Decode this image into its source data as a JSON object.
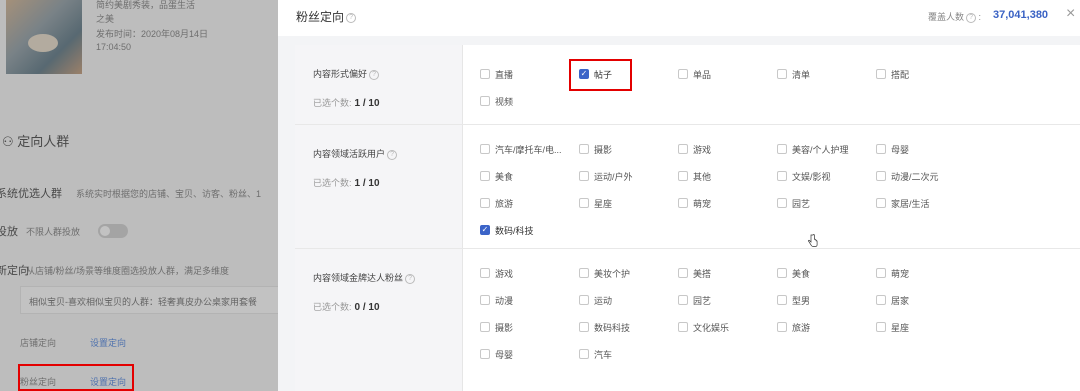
{
  "background": {
    "product_title_line1": "简约美剧秀装，品蛋生活",
    "product_title_line2": "之美",
    "publish_label": "发布时间：2020年08月14日",
    "publish_time": "17:04:50",
    "targeting_heading": "定向人群",
    "system_crowd_label": "系统优选人群",
    "system_crowd_desc": "系统实时根据您的店铺、宝贝、访客、粉丝、1",
    "delivery_label": "投放",
    "delivery_desc": "不限人群投放",
    "custom_label": "新定向",
    "custom_desc": "从店铺/粉丝/场景等维度圈选投放人群，满足多维度",
    "similar_text": "相似宝贝-喜欢相似宝贝的人群：轻奢真皮办公桌家用套餐",
    "store_targeting_label": "店铺定向",
    "store_targeting_link": "设置定向",
    "fan_targeting_label": "粉丝定向",
    "fan_targeting_link": "设置定向"
  },
  "drawer": {
    "title": "粉丝定向",
    "audience_label": "覆盖人数",
    "audience_value": "37,041,380",
    "sections": [
      {
        "label": "内容形式偏好",
        "count_label": "已选个数:",
        "count_value": "1 / 10",
        "options": [
          {
            "label": "直播",
            "checked": false
          },
          {
            "label": "帖子",
            "checked": true
          },
          {
            "label": "单品",
            "checked": false
          },
          {
            "label": "清单",
            "checked": false
          },
          {
            "label": "搭配",
            "checked": false
          },
          {
            "label": "视频",
            "checked": false
          }
        ]
      },
      {
        "label": "内容领域活跃用户",
        "count_label": "已选个数:",
        "count_value": "1 / 10",
        "options": [
          {
            "label": "汽车/摩托车/电...",
            "checked": false
          },
          {
            "label": "摄影",
            "checked": false
          },
          {
            "label": "游戏",
            "checked": false
          },
          {
            "label": "美容/个人护理",
            "checked": false
          },
          {
            "label": "母婴",
            "checked": false
          },
          {
            "label": "美食",
            "checked": false
          },
          {
            "label": "运动/户外",
            "checked": false
          },
          {
            "label": "其他",
            "checked": false
          },
          {
            "label": "文娱/影视",
            "checked": false
          },
          {
            "label": "动漫/二次元",
            "checked": false
          },
          {
            "label": "旅游",
            "checked": false
          },
          {
            "label": "星座",
            "checked": false
          },
          {
            "label": "萌宠",
            "checked": false
          },
          {
            "label": "园艺",
            "checked": false
          },
          {
            "label": "家居/生活",
            "checked": false
          },
          {
            "label": "数码/科技",
            "checked": true
          }
        ]
      },
      {
        "label": "内容领域金牌达人粉丝",
        "count_label": "已选个数:",
        "count_value": "0 / 10",
        "options": [
          {
            "label": "游戏",
            "checked": false
          },
          {
            "label": "美妆个护",
            "checked": false
          },
          {
            "label": "美搭",
            "checked": false
          },
          {
            "label": "美食",
            "checked": false
          },
          {
            "label": "萌宠",
            "checked": false
          },
          {
            "label": "动漫",
            "checked": false
          },
          {
            "label": "运动",
            "checked": false
          },
          {
            "label": "园艺",
            "checked": false
          },
          {
            "label": "型男",
            "checked": false
          },
          {
            "label": "居家",
            "checked": false
          },
          {
            "label": "摄影",
            "checked": false
          },
          {
            "label": "数码科技",
            "checked": false
          },
          {
            "label": "文化娱乐",
            "checked": false
          },
          {
            "label": "旅游",
            "checked": false
          },
          {
            "label": "星座",
            "checked": false
          },
          {
            "label": "母婴",
            "checked": false
          },
          {
            "label": "汽车",
            "checked": false
          }
        ]
      }
    ]
  },
  "colors": {
    "accent": "#3b64c8",
    "highlight": "#e30000",
    "audience_value": "#3a62c4"
  }
}
